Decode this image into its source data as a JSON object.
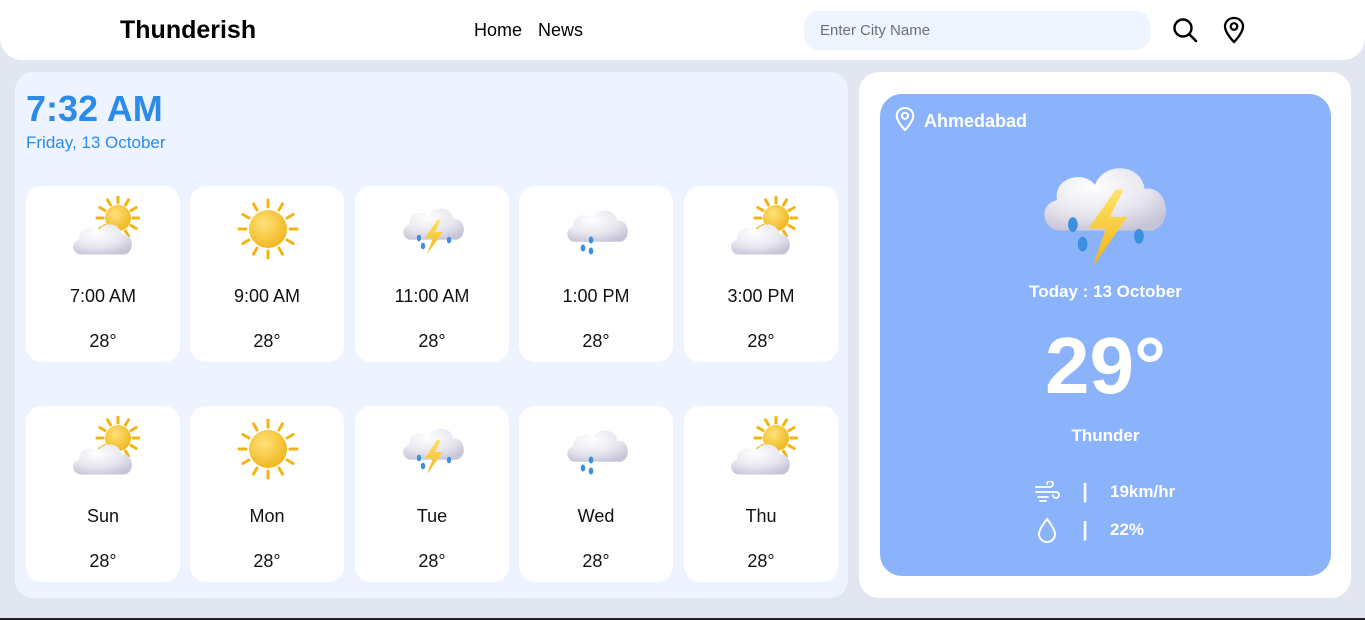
{
  "header": {
    "brand": "Thunderish",
    "nav": [
      "Home",
      "News"
    ],
    "search_placeholder": "Enter City Name",
    "icons": [
      "search-icon",
      "location-pin-icon"
    ]
  },
  "clock": {
    "time": "7:32 AM",
    "date": "Friday, 13 October"
  },
  "hourly": [
    {
      "label": "7:00 AM",
      "temp": "28°",
      "icon": "partly-cloudy-icon"
    },
    {
      "label": "9:00 AM",
      "temp": "28°",
      "icon": "sun-icon"
    },
    {
      "label": "11:00 AM",
      "temp": "28°",
      "icon": "thunderstorm-icon"
    },
    {
      "label": "1:00 PM",
      "temp": "28°",
      "icon": "rain-cloud-icon"
    },
    {
      "label": "3:00 PM",
      "temp": "28°",
      "icon": "partly-cloudy-icon"
    }
  ],
  "daily": [
    {
      "label": "Sun",
      "temp": "28°",
      "icon": "partly-cloudy-icon"
    },
    {
      "label": "Mon",
      "temp": "28°",
      "icon": "sun-icon"
    },
    {
      "label": "Tue",
      "temp": "28°",
      "icon": "thunderstorm-icon"
    },
    {
      "label": "Wed",
      "temp": "28°",
      "icon": "rain-cloud-icon"
    },
    {
      "label": "Thu",
      "temp": "28°",
      "icon": "partly-cloudy-icon"
    }
  ],
  "today": {
    "city": "Ahmedabad",
    "date": "Today : 13 October",
    "temp": "29°",
    "condition": "Thunder",
    "wind": "19km/hr",
    "humidity": "22%",
    "separator": "|",
    "icon": "thunderstorm-icon"
  },
  "colors": {
    "accent": "#2b8be8",
    "today_card": "#8ab3fc",
    "panel": "#eef4ff",
    "background": "#e1e6f0"
  }
}
